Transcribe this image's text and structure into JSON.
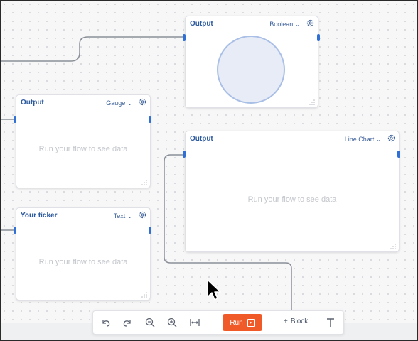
{
  "nodes": {
    "boolean_output": {
      "title": "Output",
      "type_label": "Boolean"
    },
    "gauge_output": {
      "title": "Output",
      "type_label": "Gauge",
      "placeholder": "Run your flow to see data"
    },
    "ticker_output": {
      "title": "Your ticker",
      "type_label": "Text",
      "placeholder": "Run your flow to see data"
    },
    "linechart_output": {
      "title": "Output",
      "type_label": "Line Chart",
      "placeholder": "Run your flow to see data"
    }
  },
  "toolbar": {
    "run_label": "Run",
    "block_label": "Block",
    "block_plus": "+",
    "icons": [
      "undo-icon",
      "redo-icon",
      "zoom-out-icon",
      "zoom-in-icon",
      "fit-width-icon",
      "text-icon"
    ]
  },
  "colors": {
    "accent": "#2f6fd6",
    "run": "#f05a28",
    "title": "#2c5a9e",
    "wire": "#8a8f98"
  }
}
